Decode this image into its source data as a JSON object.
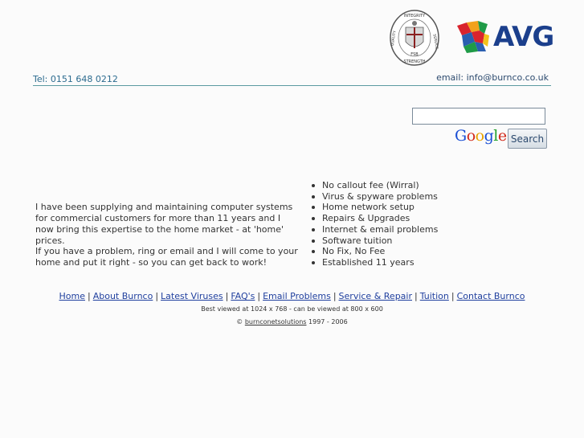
{
  "header": {
    "seal_texts": [
      "INTEGRITY",
      "SERVICE",
      "STRENGTH",
      "QUALITY",
      "FSB"
    ],
    "avg_logo": "AVG",
    "tel": "Tel:  0151 648 0212",
    "email": "email: info@burnco.co.uk"
  },
  "search": {
    "value": "",
    "google_logo": "Google",
    "button_label": "Search"
  },
  "intro": {
    "p1": "I have been supplying and maintaining computer systems for commercial customers for more than 11 years and I now bring this expertise to the home market - at 'home' prices.",
    "p2": "If you have a problem, ring or email and I will come to your home and put it right - so you can get back to work!"
  },
  "features": [
    "No callout fee (Wirral)",
    "Virus & spyware problems",
    "Home network setup",
    "Repairs & Upgrades",
    "Internet & email problems",
    "Software tuition",
    "No Fix, No Fee",
    "Established 11 years"
  ],
  "nav": [
    "Home",
    "About Burnco",
    "Latest Viruses",
    "FAQ's",
    "Email Problems",
    "Service & Repair",
    "Tuition",
    "Contact Burnco"
  ],
  "footer": {
    "best_viewed": "Best viewed at 1024 x 768 - can be viewed at 800 x 600",
    "copyright_symbol": "©",
    "owner": "burnconetsolutions",
    "years": "1997 - 2006"
  }
}
